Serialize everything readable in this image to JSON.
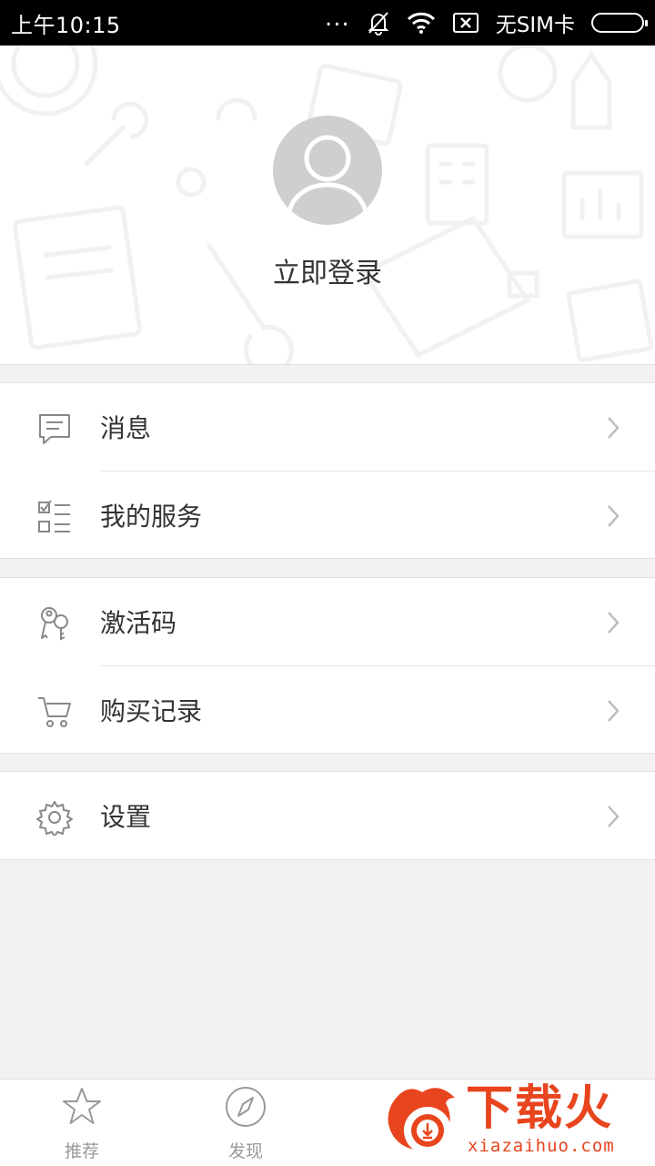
{
  "status_bar": {
    "time": "上午10:15",
    "dots": "...",
    "sim_text": "无SIM卡",
    "icons": [
      "mute-bell-icon",
      "wifi-icon",
      "no-sim-icon",
      "battery-icon"
    ]
  },
  "header": {
    "login_label": "立即登录",
    "avatar_icon": "default-avatar-icon"
  },
  "menu": {
    "group1": [
      {
        "label": "消息",
        "icon": "message-icon"
      },
      {
        "label": "我的服务",
        "icon": "checklist-icon"
      }
    ],
    "group2": [
      {
        "label": "激活码",
        "icon": "keys-icon"
      },
      {
        "label": "购买记录",
        "icon": "cart-icon"
      }
    ],
    "group3": [
      {
        "label": "设置",
        "icon": "gear-icon"
      }
    ]
  },
  "bottom_nav": {
    "tabs": [
      {
        "label": "推荐",
        "icon": "star-icon"
      },
      {
        "label": "发现",
        "icon": "compass-icon"
      }
    ]
  },
  "watermark": {
    "title": "下载火",
    "subtitle": "xiazaihuo.com"
  },
  "colors": {
    "accent": "#e8451e",
    "background": "#f2f2f2",
    "icon_gray": "#888888",
    "chevron": "#bdbdbd"
  }
}
